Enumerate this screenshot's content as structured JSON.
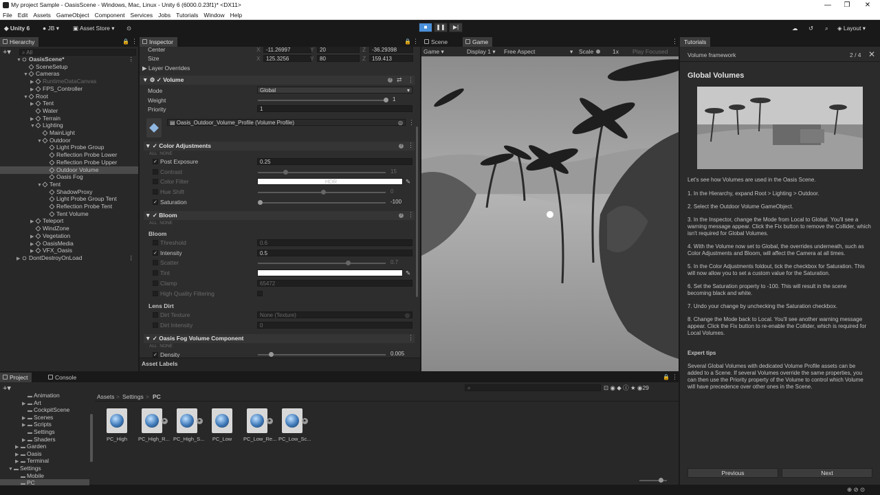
{
  "window": {
    "title": "My project Sample - OasisScene - Windows, Mac, Linux - Unity 6 (6000.0.23f1)* <DX11>",
    "controls": [
      "—",
      "❐",
      "✕"
    ]
  },
  "menu": [
    "File",
    "Edit",
    "Assets",
    "GameObject",
    "Component",
    "Services",
    "Jobs",
    "Tutorials",
    "Window",
    "Help"
  ],
  "toolbar": {
    "logo": "Unity 6",
    "account": "JB",
    "asset_store": "Asset Store",
    "layout": "Layout"
  },
  "hierarchy": {
    "tab": "Hierarchy",
    "search_placeholder": "All",
    "items": [
      {
        "label": "OasisScene*",
        "depth": 0,
        "arrow": "▼",
        "bold": true,
        "icon": "unity"
      },
      {
        "label": "SceneSetup",
        "depth": 1,
        "arrow": "",
        "icon": "cube"
      },
      {
        "label": "Cameras",
        "depth": 1,
        "arrow": "▼",
        "icon": "cube"
      },
      {
        "label": "RuntimeDataCanvas",
        "depth": 2,
        "arrow": "▶",
        "icon": "cube",
        "dim": true
      },
      {
        "label": "FPS_Controller",
        "depth": 2,
        "arrow": "▶",
        "icon": "cube"
      },
      {
        "label": "Root",
        "depth": 1,
        "arrow": "▼",
        "icon": "cube"
      },
      {
        "label": "Tent",
        "depth": 2,
        "arrow": "▶",
        "icon": "cube"
      },
      {
        "label": "Water",
        "depth": 2,
        "arrow": "",
        "icon": "cube"
      },
      {
        "label": "Terrain",
        "depth": 2,
        "arrow": "▶",
        "icon": "cube"
      },
      {
        "label": "Lighting",
        "depth": 2,
        "arrow": "▼",
        "icon": "cube"
      },
      {
        "label": "MainLight",
        "depth": 3,
        "arrow": "",
        "icon": "cube"
      },
      {
        "label": "Outdoor",
        "depth": 3,
        "arrow": "▼",
        "icon": "cube"
      },
      {
        "label": "Light Probe Group",
        "depth": 4,
        "arrow": "",
        "icon": "cube"
      },
      {
        "label": "Reflection Probe Lower",
        "depth": 4,
        "arrow": "",
        "icon": "cube"
      },
      {
        "label": "Reflection Probe Upper",
        "depth": 4,
        "arrow": "",
        "icon": "cube"
      },
      {
        "label": "Outdoor Volume",
        "depth": 4,
        "arrow": "",
        "icon": "cube",
        "selected": true
      },
      {
        "label": "Oasis Fog",
        "depth": 4,
        "arrow": "",
        "icon": "cube"
      },
      {
        "label": "Tent",
        "depth": 3,
        "arrow": "▼",
        "icon": "cube"
      },
      {
        "label": "ShadowProxy",
        "depth": 4,
        "arrow": "",
        "icon": "cube"
      },
      {
        "label": "Light Probe Group Tent",
        "depth": 4,
        "arrow": "",
        "icon": "cube"
      },
      {
        "label": "Reflection Probe Tent",
        "depth": 4,
        "arrow": "",
        "icon": "cube"
      },
      {
        "label": "Tent Volume",
        "depth": 4,
        "arrow": "",
        "icon": "cube"
      },
      {
        "label": "Teleport",
        "depth": 2,
        "arrow": "▶",
        "icon": "cube"
      },
      {
        "label": "WindZone",
        "depth": 2,
        "arrow": "",
        "icon": "cube"
      },
      {
        "label": "Vegetation",
        "depth": 2,
        "arrow": "▶",
        "icon": "cube"
      },
      {
        "label": "OasisMedia",
        "depth": 2,
        "arrow": "▶",
        "icon": "cube"
      },
      {
        "label": "VFX_Oasis",
        "depth": 2,
        "arrow": "▶",
        "icon": "cube"
      },
      {
        "label": "DontDestroyOnLoad",
        "depth": 0,
        "arrow": "▶",
        "icon": "unity"
      }
    ]
  },
  "inspector": {
    "tab": "Inspector",
    "center": {
      "label": "Center",
      "x": "-11.26997",
      "y": "20",
      "z": "-36.29398"
    },
    "size": {
      "label": "Size",
      "x": "125.3256",
      "y": "80",
      "z": "159.413"
    },
    "layer_overrides": "Layer Overrides",
    "volume": {
      "title": "Volume",
      "mode_label": "Mode",
      "mode": "Global",
      "weight_label": "Weight",
      "weight": "1",
      "priority_label": "Priority",
      "priority": "1",
      "profile": "Oasis_Outdoor_Volume_Profile (Volume Profile)"
    },
    "all": "ALL",
    "none": "NONE",
    "color_adjustments": {
      "title": "Color Adjustments",
      "rows": [
        {
          "label": "Post Exposure",
          "value": "0.25",
          "checked": true,
          "dim": false,
          "kind": "field"
        },
        {
          "label": "Contrast",
          "value": "15",
          "checked": false,
          "dim": true,
          "kind": "slider",
          "pos": 0.2
        },
        {
          "label": "Color Filter",
          "value": "HDR",
          "checked": false,
          "dim": true,
          "kind": "color"
        },
        {
          "label": "Hue Shift",
          "value": "0",
          "checked": false,
          "dim": true,
          "kind": "slider",
          "pos": 0.5
        },
        {
          "label": "Saturation",
          "value": "-100",
          "checked": true,
          "dim": false,
          "kind": "slider",
          "pos": 0.0
        }
      ]
    },
    "bloom": {
      "title": "Bloom",
      "sub": "Bloom",
      "rows": [
        {
          "label": "Threshold",
          "value": "0.6",
          "checked": false,
          "dim": true,
          "kind": "field"
        },
        {
          "label": "Intensity",
          "value": "0.5",
          "checked": true,
          "dim": false,
          "kind": "field"
        },
        {
          "label": "Scatter",
          "value": "0.7",
          "checked": false,
          "dim": true,
          "kind": "slider",
          "pos": 0.7
        },
        {
          "label": "Tint",
          "value": "",
          "checked": false,
          "dim": true,
          "kind": "color"
        },
        {
          "label": "Clamp",
          "value": "65472",
          "checked": false,
          "dim": true,
          "kind": "field"
        },
        {
          "label": "High Quality Filtering",
          "value": "",
          "checked": false,
          "dim": true,
          "kind": "check"
        }
      ]
    },
    "lens_dirt": {
      "title": "Lens Dirt",
      "rows": [
        {
          "label": "Dirt Texture",
          "value": "None (Texture)"
        },
        {
          "label": "Dirt Intensity",
          "value": "0"
        }
      ]
    },
    "oasis_fog": {
      "title": "Oasis Fog Volume Component",
      "density_label": "Density",
      "density": "0.005"
    },
    "asset_labels": "Asset Labels"
  },
  "game": {
    "tabs": [
      "Scene",
      "Game"
    ],
    "game_label": "Game",
    "display": "Display 1",
    "aspect": "Free Aspect",
    "scale_label": "Scale",
    "scale": "1x",
    "play_focused": "Play Focused"
  },
  "tutorial": {
    "tab": "Tutorials",
    "header": "Volume framework",
    "page": "2 / 4",
    "title": "Global Volumes",
    "paragraphs": [
      "Let's see how Volumes are used in the Oasis Scene.",
      "1. In the Hierarchy, expand Root > Lighting > Outdoor.",
      "2. Select the Outdoor Volume GameObject.",
      "3. In the Inspector, change the Mode from Local to Global. You'll see a warning message appear. Click the Fix button to remove the Collider, which isn't required for Global Volumes.",
      "4. With the Volume now set to Global, the overrides underneath, such as Color Adjustments and Bloom, will affect the Camera at all times.",
      "5. In the Color Adjustments foldout, tick the checkbox for Saturation. This will now allow you to set a custom value for the Saturation.",
      "6. Set the Saturation property to -100. This will result in the scene becoming black and white.",
      "7. Undo your change by unchecking the Saturation checkbox.",
      "8. Change the Mode back to Local. You'll see another warning message appear. Click the Fix button to re-enable the Collider, which is required for Local Volumes."
    ],
    "expert_title": "Expert tips",
    "expert": "Several Global Volumes with dedicated Volume Profile assets can be added to a Scene. If several Volumes override the same properties, you can then use the Priority property of the Volume to control which Volume will have precedence over other ones in the Scene.",
    "prev": "Previous",
    "next": "Next"
  },
  "project": {
    "tabs": [
      "Project",
      "Console"
    ],
    "breadcrumb": [
      "Assets",
      "Settings",
      "PC"
    ],
    "count": "29",
    "tree": [
      {
        "label": "Animation",
        "depth": 2,
        "arrow": ""
      },
      {
        "label": "Art",
        "depth": 2,
        "arrow": "▶"
      },
      {
        "label": "CockpitScene",
        "depth": 2,
        "arrow": ""
      },
      {
        "label": "Scenes",
        "depth": 2,
        "arrow": "▶"
      },
      {
        "label": "Scripts",
        "depth": 2,
        "arrow": "▶"
      },
      {
        "label": "Settings",
        "depth": 2,
        "arrow": ""
      },
      {
        "label": "Shaders",
        "depth": 2,
        "arrow": "▶"
      },
      {
        "label": "Garden",
        "depth": 1,
        "arrow": "▶"
      },
      {
        "label": "Oasis",
        "depth": 1,
        "arrow": "▶"
      },
      {
        "label": "Terminal",
        "depth": 1,
        "arrow": "▶"
      },
      {
        "label": "Settings",
        "depth": 0,
        "arrow": "▼"
      },
      {
        "label": "Mobile",
        "depth": 1,
        "arrow": ""
      },
      {
        "label": "PC",
        "depth": 1,
        "arrow": "",
        "selected": true
      }
    ],
    "assets": [
      {
        "label": "PC_High",
        "play": false
      },
      {
        "label": "PC_High_R...",
        "play": true
      },
      {
        "label": "PC_High_S...",
        "play": true
      },
      {
        "label": "PC_Low",
        "play": false
      },
      {
        "label": "PC_Low_Re...",
        "play": true
      },
      {
        "label": "PC_Low_Sc...",
        "play": true
      }
    ]
  }
}
